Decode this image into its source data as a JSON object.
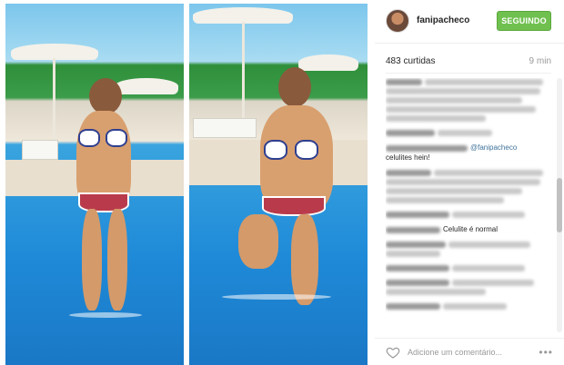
{
  "post": {
    "username": "fanipacheco",
    "follow_label": "SEGUINDO",
    "likes": "483 curtidas",
    "time": "9 min"
  },
  "comments": {
    "visible_texts": [
      "@fanipacheco",
      "celulites hein!",
      "Celulite é normal"
    ]
  },
  "footer": {
    "comment_placeholder": "Adicione um comentário...",
    "more_label": "•••"
  },
  "icons": {
    "like": "heart-icon",
    "options": "more-options-icon",
    "avatar": "avatar"
  },
  "colors": {
    "follow_button": "#70c050",
    "mention": "#3f729b",
    "pool_blue": "#1f8ad8"
  }
}
